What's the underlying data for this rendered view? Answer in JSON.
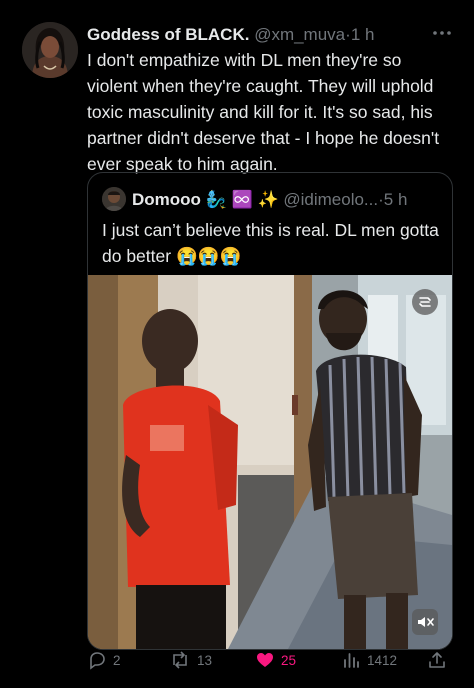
{
  "tweet": {
    "display_name": "Goddess of BLACK.",
    "handle": "@xm_muva",
    "separator": "·",
    "time": "1 h",
    "text": "I don't empathize with DL men they're so violent when they're caught. They will uphold toxic masculinity and kill for it. It's so sad, his partner didn't deserve that - I hope he doesn't ever speak to him again."
  },
  "quote": {
    "display_name": "Domooo",
    "name_emojis": "🧞‍♂️ ♾️ ✨",
    "handle": "@idimeolo...",
    "separator": "·",
    "time": "5 h",
    "text": "I just can’t believe this is real. DL men gotta do better",
    "text_emojis": "😭😭😭",
    "media_icons": [
      "quality-icon",
      "volume-muted-icon"
    ]
  },
  "actions": {
    "replies": "2",
    "retweets": "13",
    "likes": "25",
    "views": "1412"
  },
  "colors": {
    "background": "#000000",
    "text": "#e7e9ea",
    "muted": "#71767b",
    "like": "#f91880",
    "border": "#2f3336"
  }
}
